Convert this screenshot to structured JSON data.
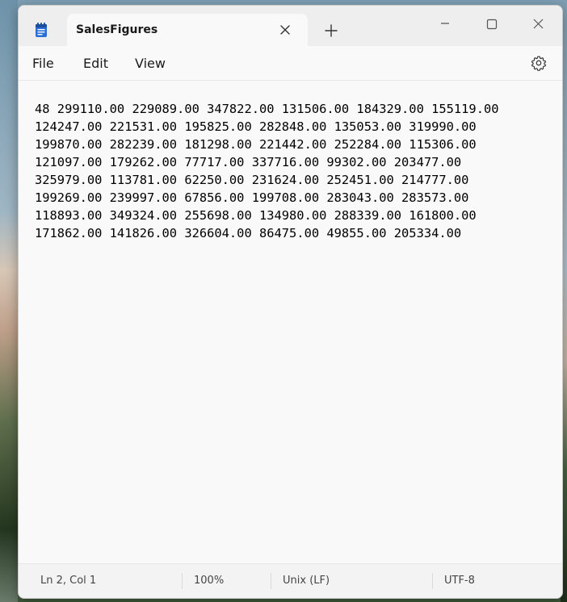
{
  "window": {
    "tab_title": "SalesFigures"
  },
  "menu": {
    "file": "File",
    "edit": "Edit",
    "view": "View"
  },
  "document": {
    "lines": [
      "48 299110.00 229089.00 347822.00 131506.00 184329.00 155119.00",
      "124247.00 221531.00 195825.00 282848.00 135053.00 319990.00",
      "199870.00 282239.00 181298.00 221442.00 252284.00 115306.00",
      "121097.00 179262.00 77717.00 337716.00 99302.00 203477.00",
      "325979.00 113781.00 62250.00 231624.00 252451.00 214777.00",
      "199269.00 239997.00 67856.00 199708.00 283043.00 283573.00",
      "118893.00 349324.00 255698.00 134980.00 288339.00 161800.00",
      "171862.00 141826.00 326604.00 86475.00 49855.00 205334.00"
    ]
  },
  "status": {
    "position": "Ln 2, Col 1",
    "zoom": "100%",
    "line_ending": "Unix (LF)",
    "encoding": "UTF-8"
  },
  "icons": {
    "app": "notepad-icon",
    "tab_close": "close-icon",
    "new_tab": "plus-icon",
    "minimize": "minimize-icon",
    "maximize": "maximize-icon",
    "close": "close-icon",
    "settings": "gear-icon"
  },
  "colors": {
    "app_icon_blue": "#2b6fd6",
    "window_bg": "#f9f9f9",
    "titlebar_bg": "#eeeeee"
  }
}
